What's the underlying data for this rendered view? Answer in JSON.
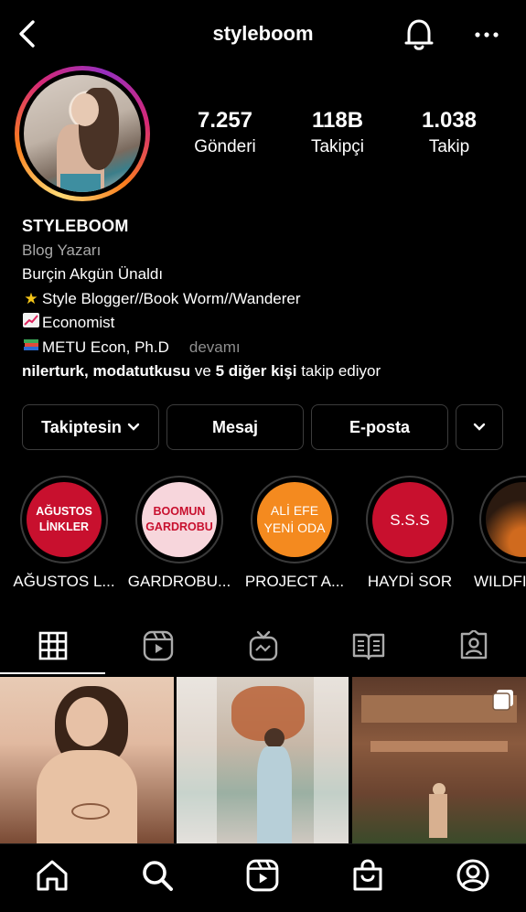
{
  "header": {
    "username": "styleboom",
    "back_icon": "back-chevron-icon",
    "bell_icon": "bell-icon",
    "more_icon": "more-horizontal-icon"
  },
  "stats": [
    {
      "value": "7.257",
      "label": "Gönderi"
    },
    {
      "value": "118B",
      "label": "Takipçi"
    },
    {
      "value": "1.038",
      "label": "Takip"
    }
  ],
  "bio": {
    "name": "STYLEBOOM",
    "category": "Blog Yazarı",
    "line1": "Burçin Akgün Ünaldı",
    "line2": "Style Blogger//Book Worm//Wanderer",
    "line3": "Economist",
    "line4": "METU Econ, Ph.D",
    "more": "devamı",
    "followed_by_names": "nilerturk, modatutkusu",
    "followed_by_and": "ve",
    "followed_by_others": "5 diğer kişi",
    "followed_by_suffix": "takip ediyor"
  },
  "buttons": {
    "following": "Takiptesin",
    "message": "Mesaj",
    "email": "E-posta"
  },
  "highlights": [
    {
      "cover_text_1": "AĞUSTOS",
      "cover_text_2": "LİNKLER",
      "label": "AĞUSTOS L...",
      "color": "#c8102e",
      "text_color": "#ffffff"
    },
    {
      "cover_text_1": "BOOMUN",
      "cover_text_2": "GARDROBU",
      "label": "GARDROBU...",
      "color": "#f7d6dc",
      "text_color": "#c8102e"
    },
    {
      "cover_text_1": "ALİ EFE",
      "cover_text_2": "YENİ ODA",
      "label": "PROJECT A...",
      "color": "#f48a1f",
      "text_color": "#ffffff"
    },
    {
      "cover_text_1": "S.S.S",
      "cover_text_2": "",
      "label": "HAYDİ SOR",
      "color": "#c8102e",
      "text_color": "#ffffff"
    },
    {
      "cover_text_1": "",
      "cover_text_2": "",
      "label": "WILDFI",
      "color": "#2b1a10",
      "text_color": "#ffffff"
    }
  ],
  "tabs": [
    "grid-icon",
    "reels-icon",
    "igtv-icon",
    "guides-icon",
    "tagged-icon"
  ],
  "bottom_nav": [
    "home-icon",
    "search-icon",
    "reels-icon",
    "shop-icon",
    "profile-icon"
  ],
  "colors": {
    "background": "#000000",
    "border": "#3c3c3c",
    "secondary_text": "#a8a8a8"
  }
}
